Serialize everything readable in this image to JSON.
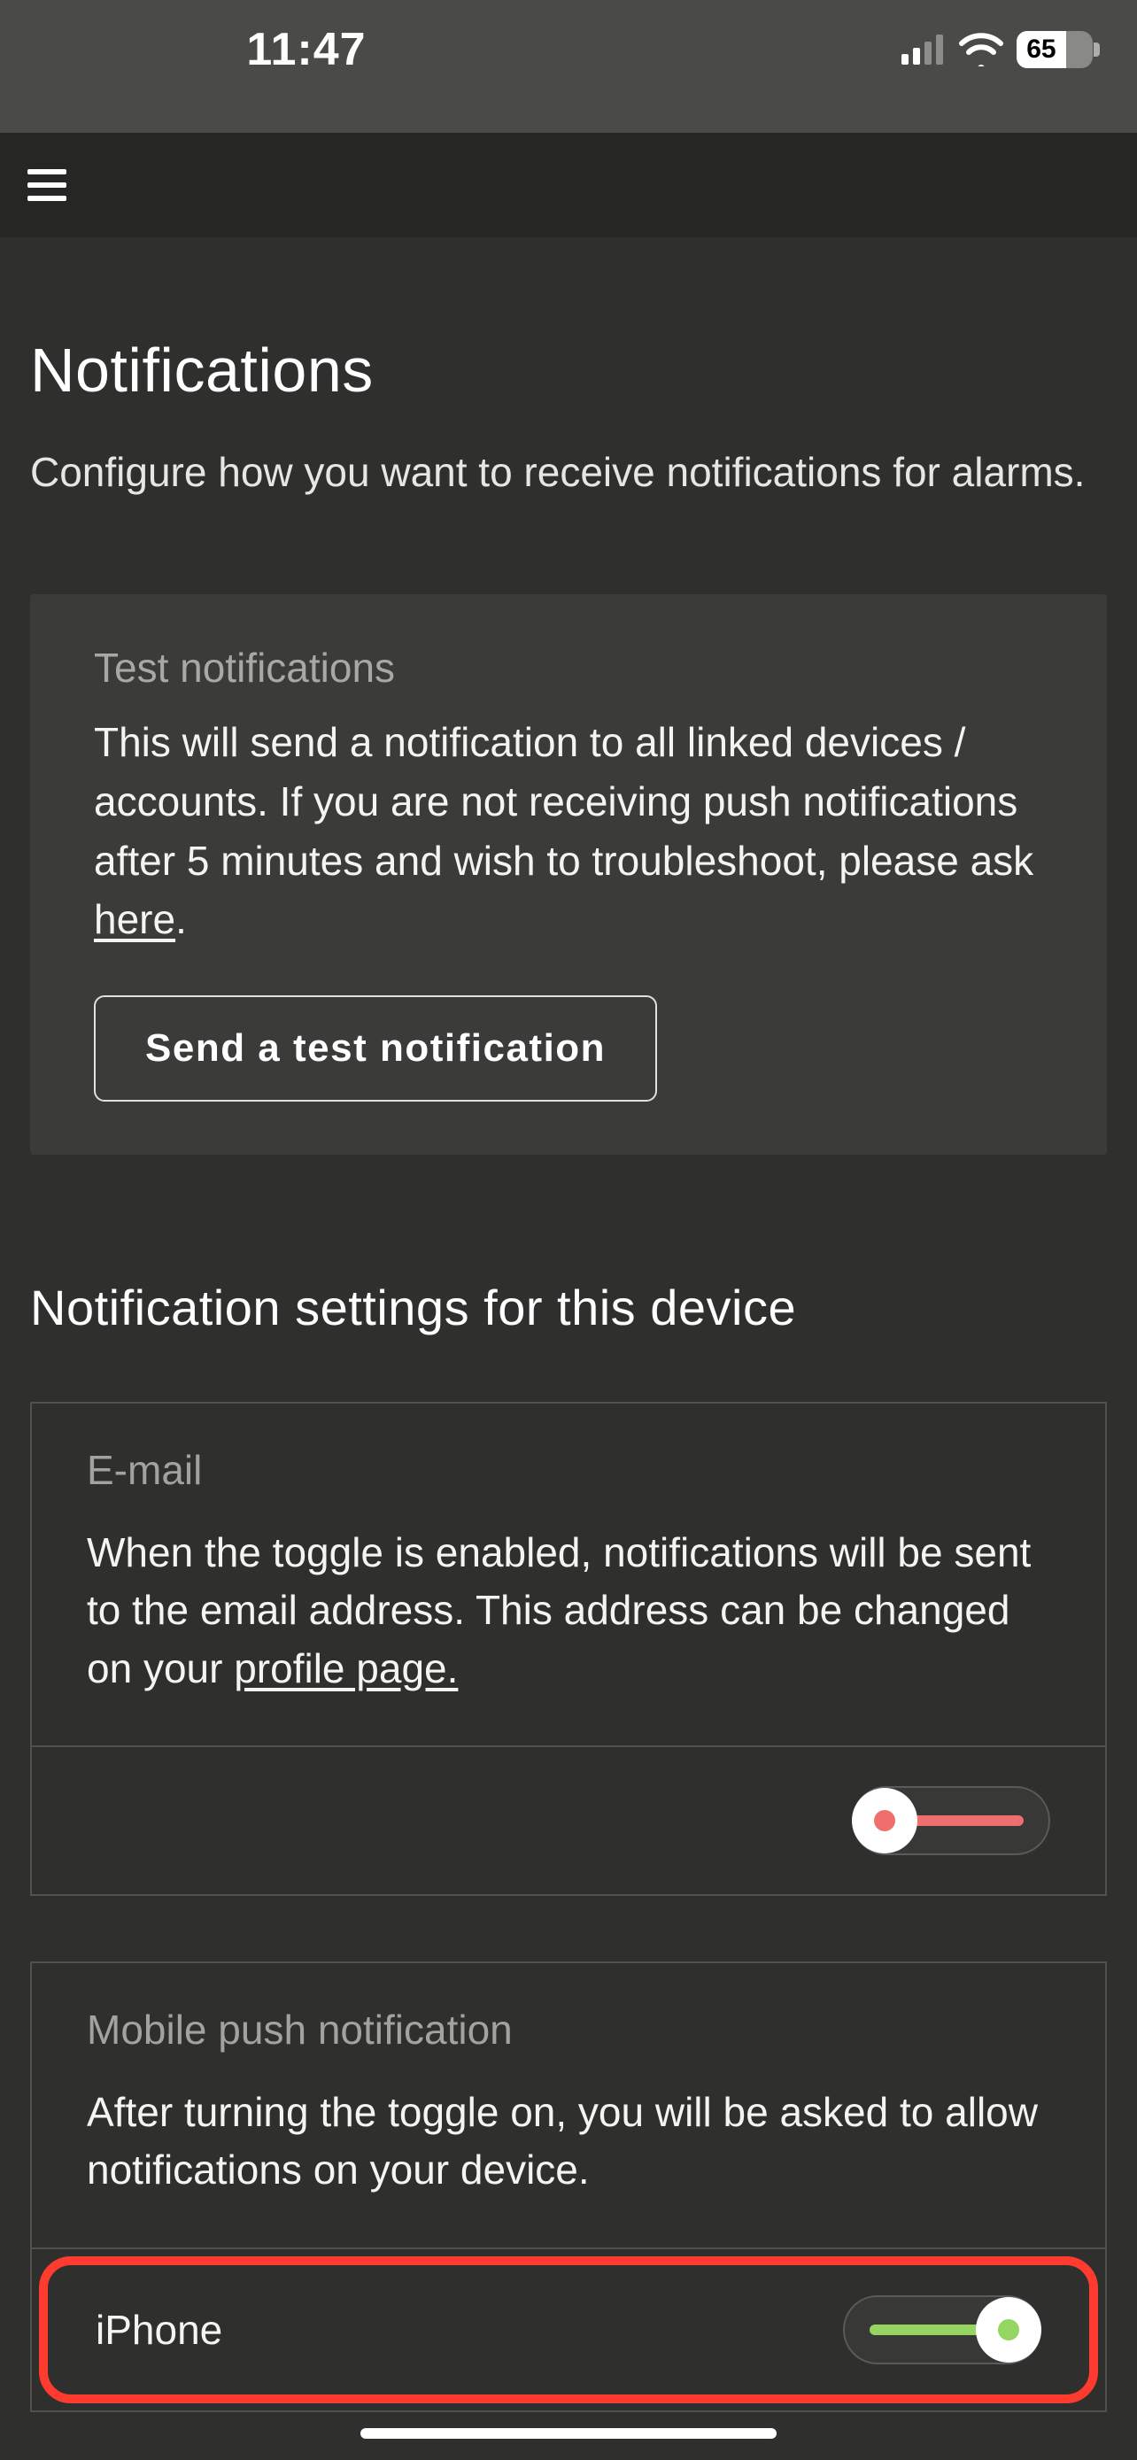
{
  "statusbar": {
    "time": "11:47",
    "battery": "65"
  },
  "page": {
    "title": "Notifications",
    "subtitle": "Configure how you want to receive notifications for alarms."
  },
  "test_card": {
    "title": "Test notifications",
    "body_before": "This will send a notification to all linked devices / accounts. If you are not receiving push notifications after 5 minutes and wish to troubleshoot, please ask ",
    "link": "here",
    "body_after": ".",
    "button": "Send a test notification"
  },
  "settings_section_title": "Notification settings for this device",
  "email_card": {
    "title": "E-mail",
    "body_before": "When the toggle is enabled, notifications will be sent to the email address. This address can be changed on your ",
    "link": "profile page.",
    "toggle_on": false
  },
  "push_card": {
    "title": "Mobile push notification",
    "body": "After turning the toggle on, you will be asked to allow notifications on your device.",
    "device_label": "iPhone",
    "toggle_on": true
  }
}
